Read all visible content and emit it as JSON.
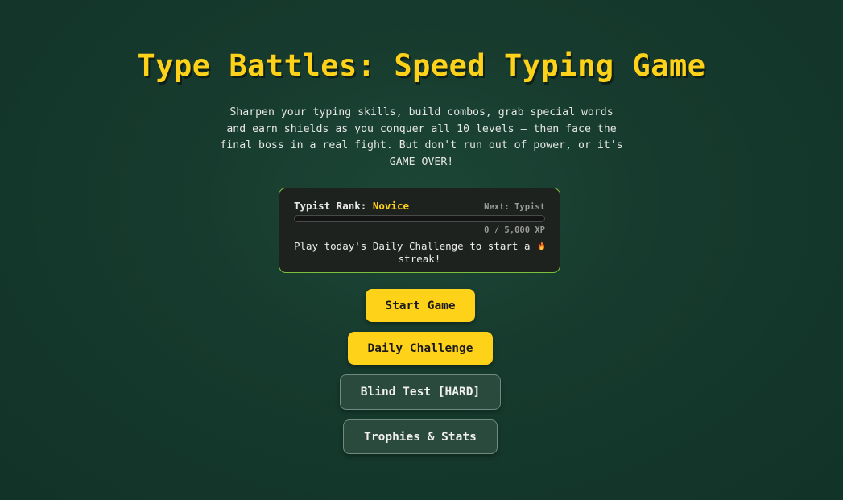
{
  "game": {
    "title": "Type Battles: Speed Typing Game",
    "subtitle": "Sharpen your typing skills, build combos, grab special words and earn shields as you conquer all 10 levels — then face the final boss in a real fight. But don't run out of power, or it's GAME OVER!"
  },
  "rank_card": {
    "rank_label": "Typist Rank:",
    "rank_value": "Novice",
    "next_rank": "Next: Typist",
    "xp_text": "0 / 5,000 XP",
    "xp_progress": 0,
    "streak_message": "Play today's Daily Challenge to start a",
    "streak_suffix": "streak!",
    "streak_icon": "fire-icon"
  },
  "menu": {
    "start_label": "Start Game",
    "daily_label": "Daily Challenge",
    "blind_label": "Blind Test [HARD]",
    "trophies_label": "Trophies & Stats"
  },
  "colors": {
    "accent": "#ffd21a",
    "card_border": "#7cbf3a",
    "background": "#163a2d"
  }
}
